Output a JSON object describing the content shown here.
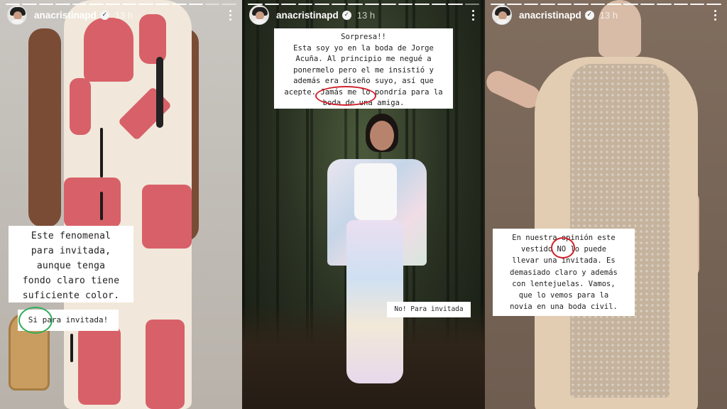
{
  "stories": [
    {
      "username": "anacristinapd",
      "time": "13 h",
      "caption": "Este fenomenal\npara invitada,\naunque tenga\nfondo claro tiene\nsuficiente color.",
      "tag": "Si para invitada!",
      "circle_color": "#2fae5a"
    },
    {
      "username": "anacristinapd",
      "time": "13 h",
      "caption": "Sorpresa!!\nEsta soy yo en la boda de Jorge\nAcuña. Al principio me negué a\nponermelo pero el me insistió y\nademás era diseño suyo, así que\nacepte. Jamás me lo pondría para la\nboda de una amiga.",
      "tag": "No! Para invitada",
      "circle_color": "#d0202a"
    },
    {
      "username": "anacristinapd",
      "time": "13 h",
      "caption": "En nuestra opinión este\nvestido NO lo puede\nllevar una invitada. Es\ndemasiado claro y además\ncon lentejuelas. Vamos,\nque lo vemos para la\nnovia en una boda civil.",
      "circle_color": "#d0202a"
    }
  ],
  "icons": {
    "verified": "verified-badge-icon",
    "menu": "more-vertical-icon"
  }
}
